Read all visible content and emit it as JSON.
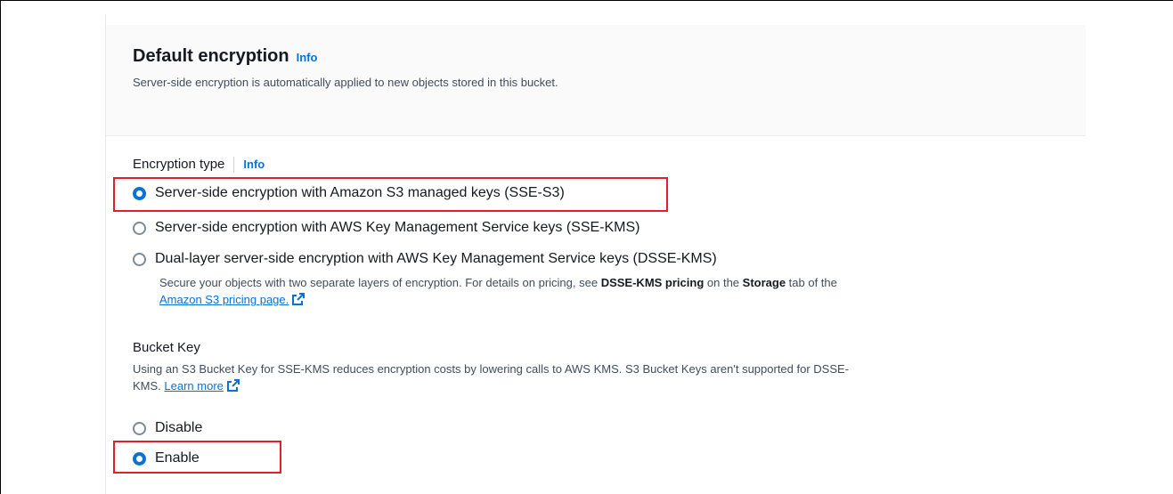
{
  "section": {
    "title": "Default encryption",
    "title_info": "Info",
    "description": "Server-side encryption is automatically applied to new objects stored in this bucket."
  },
  "encryption_type": {
    "label": "Encryption type",
    "info": "Info",
    "options": [
      {
        "label": "Server-side encryption with Amazon S3 managed keys (SSE-S3)",
        "selected": true
      },
      {
        "label": "Server-side encryption with AWS Key Management Service keys (SSE-KMS)",
        "selected": false
      },
      {
        "label": "Dual-layer server-side encryption with AWS Key Management Service keys (DSSE-KMS)",
        "selected": false
      }
    ],
    "dsse_desc": {
      "part1": "Secure your objects with two separate layers of encryption. For details on pricing, see ",
      "bold1": "DSSE-KMS pricing",
      "part2": " on the ",
      "bold2": "Storage",
      "part3": " tab of the",
      "link": "Amazon S3 pricing page."
    }
  },
  "bucket_key": {
    "label": "Bucket Key",
    "desc_line1": "Using an S3 Bucket Key for SSE-KMS reduces encryption costs by lowering calls to AWS KMS. S3 Bucket Keys aren't supported for DSSE-",
    "desc_line2": "KMS. ",
    "learn_more": "Learn more",
    "options": [
      {
        "label": "Disable",
        "selected": false
      },
      {
        "label": "Enable",
        "selected": true
      }
    ]
  },
  "colors": {
    "accent": "#0972d3",
    "highlight": "#e0202f"
  }
}
